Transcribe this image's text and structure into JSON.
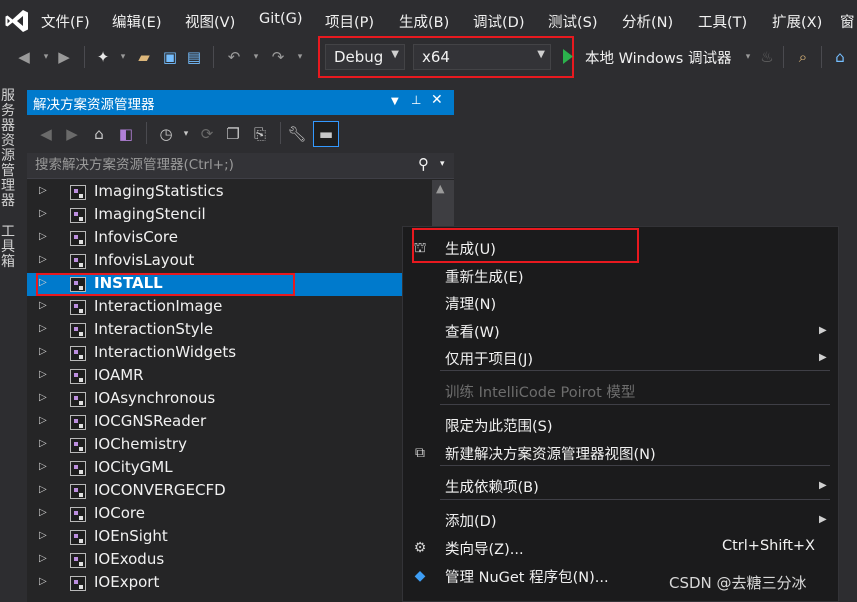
{
  "menubar": {
    "logo": "visual-studio-logo",
    "items": [
      "文件(F)",
      "编辑(E)",
      "视图(V)",
      "Git(G)",
      "项目(P)",
      "生成(B)",
      "调试(D)",
      "测试(S)",
      "分析(N)",
      "工具(T)",
      "扩展(X)",
      "窗"
    ]
  },
  "toolbar": {
    "configuration": "Debug",
    "platform": "x64",
    "run_target": "本地 Windows 调试器"
  },
  "side_tabs": [
    "服务器资源管理器",
    "工具箱"
  ],
  "solution_explorer": {
    "title": "解决方案资源管理器",
    "search_placeholder": "搜索解决方案资源管理器(Ctrl+;)",
    "items": [
      {
        "label": "ImagingStatistics",
        "selected": false
      },
      {
        "label": "ImagingStencil",
        "selected": false
      },
      {
        "label": "InfovisCore",
        "selected": false
      },
      {
        "label": "InfovisLayout",
        "selected": false
      },
      {
        "label": "INSTALL",
        "selected": true
      },
      {
        "label": "InteractionImage",
        "selected": false
      },
      {
        "label": "InteractionStyle",
        "selected": false
      },
      {
        "label": "InteractionWidgets",
        "selected": false
      },
      {
        "label": "IOAMR",
        "selected": false
      },
      {
        "label": "IOAsynchronous",
        "selected": false
      },
      {
        "label": "IOCGNSReader",
        "selected": false
      },
      {
        "label": "IOChemistry",
        "selected": false
      },
      {
        "label": "IOCityGML",
        "selected": false
      },
      {
        "label": "IOCONVERGECFD",
        "selected": false
      },
      {
        "label": "IOCore",
        "selected": false
      },
      {
        "label": "IOEnSight",
        "selected": false
      },
      {
        "label": "IOExodus",
        "selected": false
      },
      {
        "label": "IOExport",
        "selected": false
      }
    ]
  },
  "context_menu": {
    "items": [
      {
        "label": "生成(U)",
        "icon": "build-icon",
        "submenu": false,
        "disabled": false
      },
      {
        "label": "重新生成(E)",
        "submenu": false,
        "disabled": false
      },
      {
        "label": "清理(N)",
        "submenu": false,
        "disabled": false
      },
      {
        "label": "查看(W)",
        "submenu": true,
        "disabled": false
      },
      {
        "label": "仅用于项目(J)",
        "submenu": true,
        "disabled": false
      },
      {
        "label": "训练 IntelliCode Poirot 模型",
        "submenu": false,
        "disabled": true
      },
      {
        "label": "限定为此范围(S)",
        "submenu": false,
        "disabled": false
      },
      {
        "label": "新建解决方案资源管理器视图(N)",
        "icon": "new-view-icon",
        "submenu": false,
        "disabled": false
      },
      {
        "label": "生成依赖项(B)",
        "submenu": true,
        "disabled": false
      },
      {
        "label": "添加(D)",
        "submenu": true,
        "disabled": false
      },
      {
        "label": "类向导(Z)...",
        "icon": "class-wizard-icon",
        "shortcut": "Ctrl+Shift+X",
        "submenu": false,
        "disabled": false
      },
      {
        "label": "管理 NuGet 程序包(N)...",
        "icon": "nuget-icon",
        "submenu": false,
        "disabled": false
      }
    ]
  },
  "watermark": "CSDN @去糖三分冰",
  "colors": {
    "accent": "#007acc",
    "highlight_box": "#e8191f",
    "background": "#2d2d30"
  }
}
